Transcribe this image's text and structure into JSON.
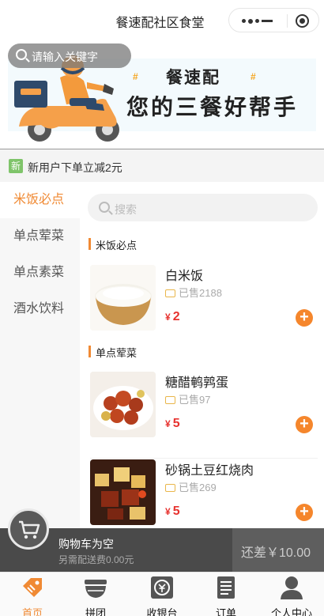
{
  "header": {
    "title": "餐速配社区食堂"
  },
  "banner": {
    "search_placeholder": "请输入关键字",
    "brand": "餐速配",
    "slogan": "您的三餐好帮手",
    "hash_mark": "#"
  },
  "promo": {
    "badge": "新",
    "text": "新用户下单立减2元"
  },
  "sidebar": {
    "items": [
      {
        "label": "米饭必点",
        "active": true
      },
      {
        "label": "单点荤菜",
        "active": false
      },
      {
        "label": "单点素菜",
        "active": false
      },
      {
        "label": "酒水饮料",
        "active": false
      }
    ]
  },
  "menu": {
    "search_placeholder": "搜索",
    "sections": [
      {
        "title": "米饭必点",
        "dishes": [
          {
            "name": "白米饭",
            "sold": "已售2188",
            "currency": "¥",
            "price": "2"
          }
        ]
      },
      {
        "title": "单点荤菜",
        "dishes": [
          {
            "name": "糖醋鹌鹑蛋",
            "sold": "已售97",
            "currency": "¥",
            "price": "5"
          },
          {
            "name": "砂锅土豆红烧肉",
            "sold": "已售269",
            "currency": "¥",
            "price": "5"
          }
        ]
      }
    ],
    "add_symbol": "+"
  },
  "cart": {
    "status": "购物车为空",
    "delivery_note": "另需配送费0.00元",
    "min_diff": "还差￥10.00"
  },
  "tabbar": {
    "tabs": [
      {
        "label": "首页",
        "icon": "home-tag-icon",
        "active": true
      },
      {
        "label": "拼团",
        "icon": "group-bowl-icon",
        "active": false
      },
      {
        "label": "收银台",
        "icon": "cashier-icon",
        "active": false
      },
      {
        "label": "订单",
        "icon": "order-list-icon",
        "active": false
      },
      {
        "label": "个人中心",
        "icon": "profile-icon",
        "active": false
      }
    ]
  },
  "colors": {
    "accent": "#f08a34",
    "price": "#e7322f",
    "add_button": "#f5862c",
    "cart_bar": "#4a4a4a",
    "promo_badge": "#7fc46a"
  }
}
